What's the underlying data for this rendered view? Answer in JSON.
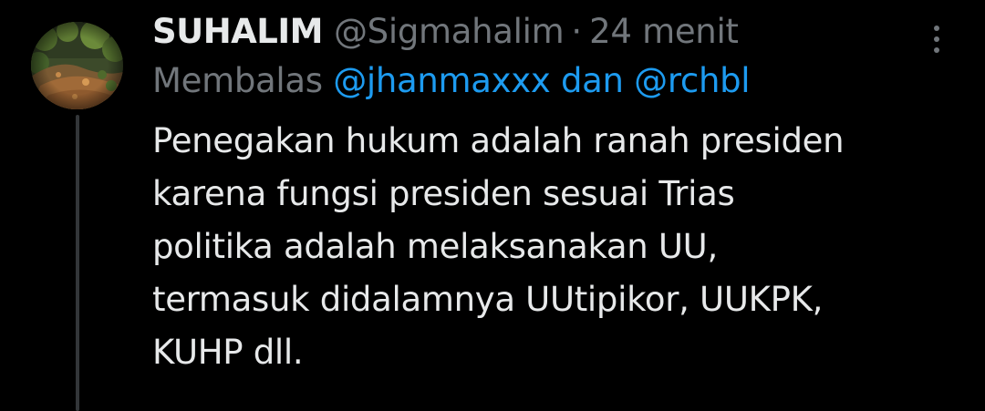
{
  "tweet": {
    "display_name": "SUHALIM",
    "handle": "@Sigmahalim",
    "separator": "·",
    "time": "24 menit",
    "reply": {
      "prefix": "Membalas",
      "mention_1": "@jhanmaxxx",
      "connector": "dan",
      "mention_2": "@rchbl"
    },
    "body_lines": [
      "Penegakan hukum adalah ranah presiden",
      "karena fungsi presiden sesuai Trias",
      "politika adalah melaksanakan UU,",
      "termasuk didalamnya UUtipikor, UUKPK,",
      "KUHP dll."
    ]
  },
  "icons": {
    "more": "more-vertical-icon",
    "avatar": "profile-photo-forest-path"
  },
  "colors": {
    "background": "#000000",
    "primary_text": "#e7e9ea",
    "secondary_text": "#71767b",
    "accent": "#1d9bf0",
    "thread_line": "#333639"
  }
}
